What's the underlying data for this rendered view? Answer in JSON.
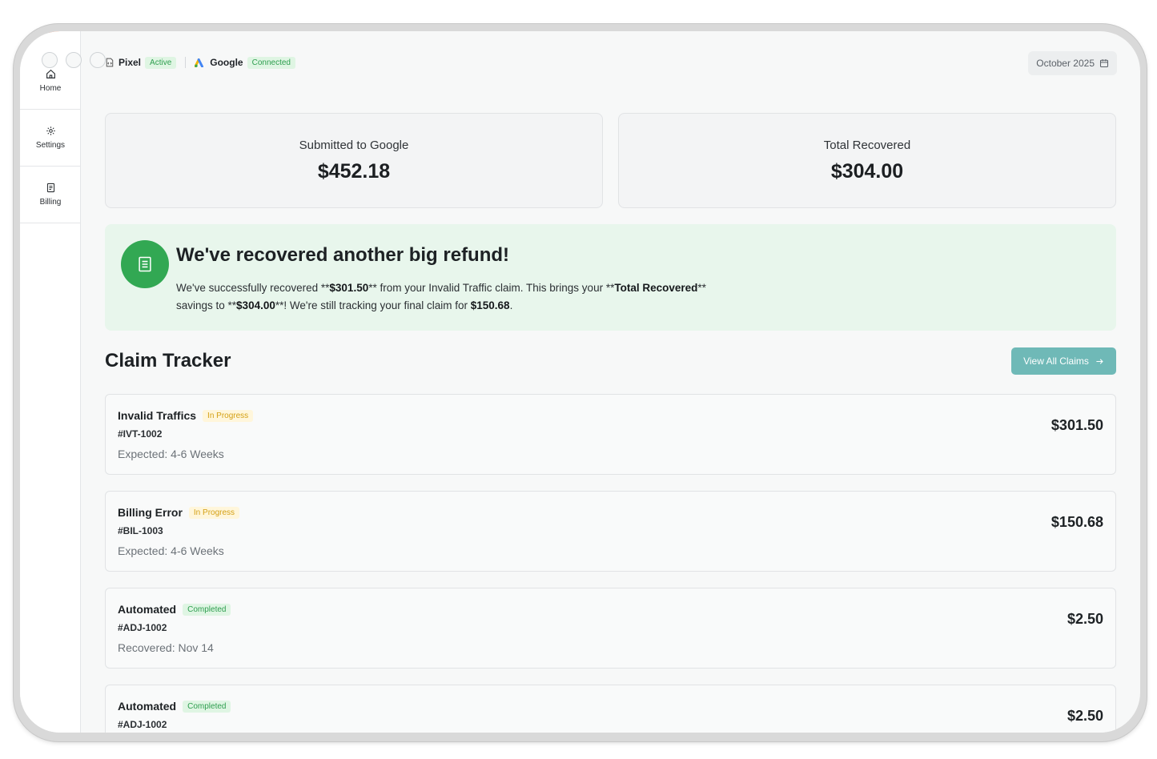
{
  "sidebar": {
    "items": [
      {
        "label": "Home",
        "icon": "home-icon"
      },
      {
        "label": "Settings",
        "icon": "gear-icon"
      },
      {
        "label": "Billing",
        "icon": "document-icon"
      }
    ]
  },
  "topbar": {
    "pixel_label": "Pixel",
    "pixel_status": "Active",
    "google_label": "Google",
    "google_status": "Connected",
    "date_label": "October 2025"
  },
  "stats": {
    "submitted_label": "Submitted to Google",
    "submitted_value": "$452.18",
    "recovered_label": "Total Recovered",
    "recovered_value": "$304.00"
  },
  "banner": {
    "title": "We've recovered another big refund!",
    "line1_a": "We've successfully recovered **",
    "line1_amount": "$301.50",
    "line1_b": "** from your Invalid Traffic claim. This brings your **",
    "line1_total_label": "Total Recovered",
    "line1_c": "**",
    "line2_a": "savings to **",
    "line2_total": "$304.00",
    "line2_b": "**! We're still tracking your final claim for ",
    "line2_final": "$150.68",
    "line2_c": "."
  },
  "claim_tracker": {
    "title": "Claim Tracker",
    "view_all_label": "View All Claims",
    "claims": [
      {
        "name": "Invalid Traffics",
        "status": "In Progress",
        "id": "#IVT-1002",
        "meta": "Expected: 4-6 Weeks",
        "amount": "$301.50"
      },
      {
        "name": "Billing Error",
        "status": "In Progress",
        "id": "#BIL-1003",
        "meta": "Expected: 4-6 Weeks",
        "amount": "$150.68"
      },
      {
        "name": "Automated",
        "status": "Completed",
        "id": "#ADJ-1002",
        "meta": "Recovered: Nov 14",
        "amount": "$2.50"
      },
      {
        "name": "Automated",
        "status": "Completed",
        "id": "#ADJ-1002",
        "meta": "",
        "amount": "$2.50"
      }
    ]
  },
  "colors": {
    "accent_green": "#32a853",
    "status_green_bg": "#dff5e3",
    "status_amber_bg": "#fff6db",
    "button_teal": "#6fb9b7"
  }
}
